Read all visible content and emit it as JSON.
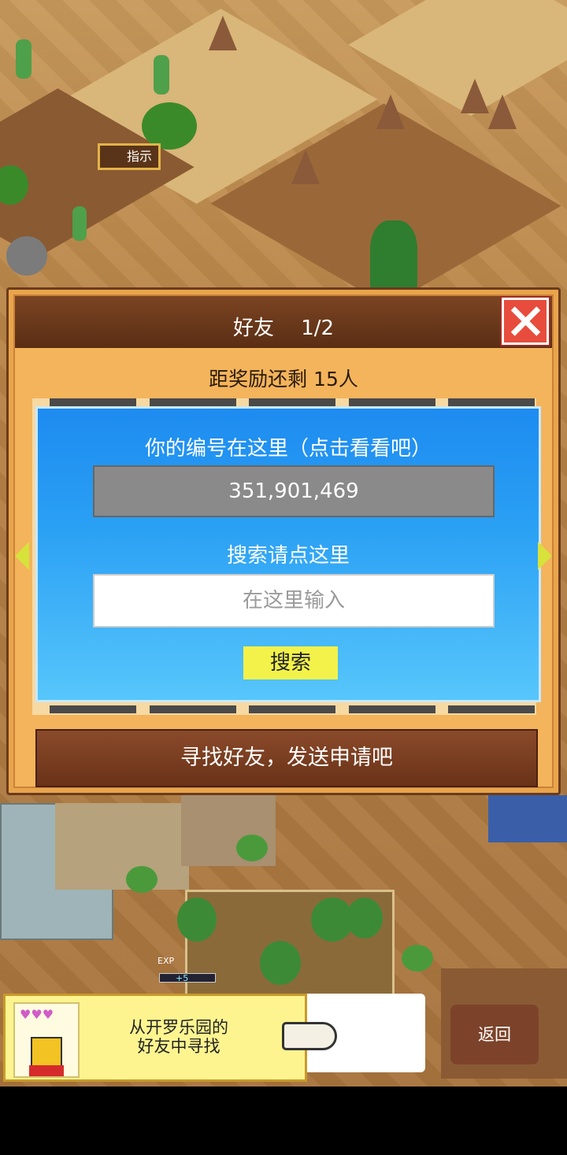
{
  "game": {
    "sign_label": "指示",
    "exp_label": "EXP",
    "exp_gain": "+5"
  },
  "dialog": {
    "title": "好友　 1/2",
    "reward_text": "距奖励还剩 15人",
    "id_label": "你的编号在这里（点击看看吧）",
    "player_id": "351,901,469",
    "search_label": "搜索请点这里",
    "search_placeholder": "在这里输入",
    "search_button": "搜索",
    "find_friends_button": "寻找好友，发送申请吧"
  },
  "banner": {
    "text_line1": "从开罗乐园的",
    "text_line2": "好友中寻找",
    "hearts": "♥♥♥"
  },
  "back_button": "返回",
  "colors": {
    "dialog_bg": "#f3b45c",
    "title_bar": "#6a3218",
    "close": "#e74c3c",
    "panel_blue": "#2aa0f4",
    "search_button": "#f2f24a",
    "banner_bg": "#fdf490"
  }
}
